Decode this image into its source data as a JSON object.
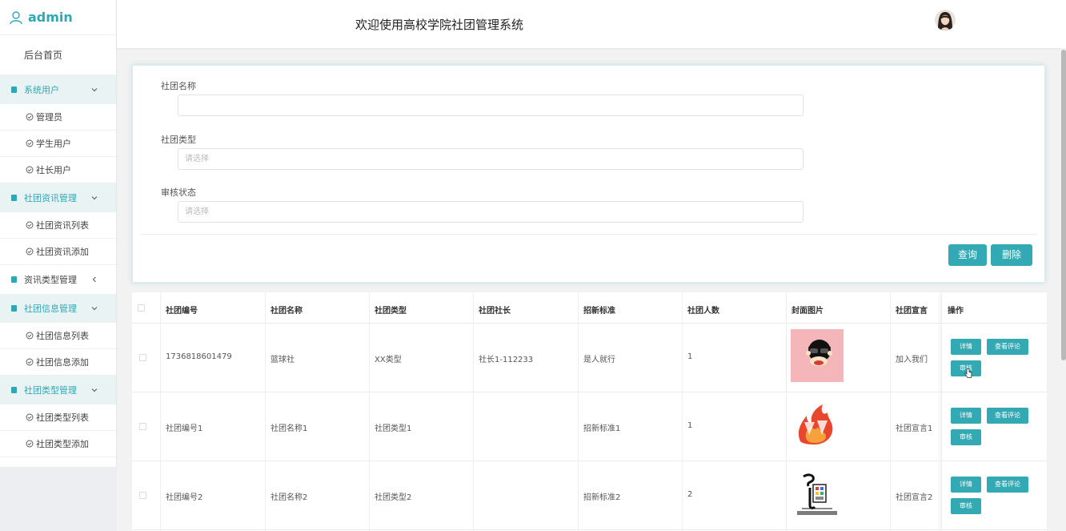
{
  "brand": {
    "username": "admin"
  },
  "header": {
    "title": "欢迎使用高校学院社团管理系统"
  },
  "sidebar": {
    "home": "后台首页",
    "groups": [
      {
        "label": "系统用户",
        "items": [
          "管理员",
          "学生用户",
          "社长用户"
        ]
      },
      {
        "label": "社团资讯管理",
        "items": [
          "社团资讯列表",
          "社团资讯添加"
        ]
      },
      {
        "label": "资讯类型管理",
        "items": []
      },
      {
        "label": "社团信息管理",
        "items": [
          "社团信息列表",
          "社团信息添加"
        ]
      },
      {
        "label": "社团类型管理",
        "items": [
          "社团类型列表",
          "社团类型添加"
        ]
      }
    ]
  },
  "search": {
    "name_label": "社团名称",
    "name_value": "",
    "type_label": "社团类型",
    "type_placeholder": "请选择",
    "status_label": "审核状态",
    "status_placeholder": "请选择",
    "query_button": "查询",
    "delete_button": "删除"
  },
  "table": {
    "headers": [
      "社团编号",
      "社团名称",
      "社团类型",
      "社团社长",
      "招新标准",
      "社团人数",
      "封面图片",
      "社团宣言",
      "操作"
    ],
    "rows": [
      {
        "id": "1736818601479",
        "name": "篮球社",
        "type": "XX类型",
        "leader": "社长1-112233",
        "standard": "是人就行",
        "count": "1",
        "cover": "monkey-face-logo",
        "slogan": "加入我们"
      },
      {
        "id": "社团编号1",
        "name": "社团名称1",
        "type": "社团类型1",
        "leader": "",
        "standard": "招新标准1",
        "count": "1",
        "cover": "flame-club-logo",
        "slogan": "社团宣言1"
      },
      {
        "id": "社团编号2",
        "name": "社团名称2",
        "type": "社团类型2",
        "leader": "",
        "standard": "招新标准2",
        "count": "2",
        "cover": "calligraphy-club-logo",
        "slogan": "社团宣言2"
      }
    ],
    "actions": {
      "detail": "详情",
      "comments": "查看评论",
      "review": "审核"
    }
  },
  "colors": {
    "accent": "#33a9b4",
    "sidebar_group_bg": "#e9f3f4"
  }
}
